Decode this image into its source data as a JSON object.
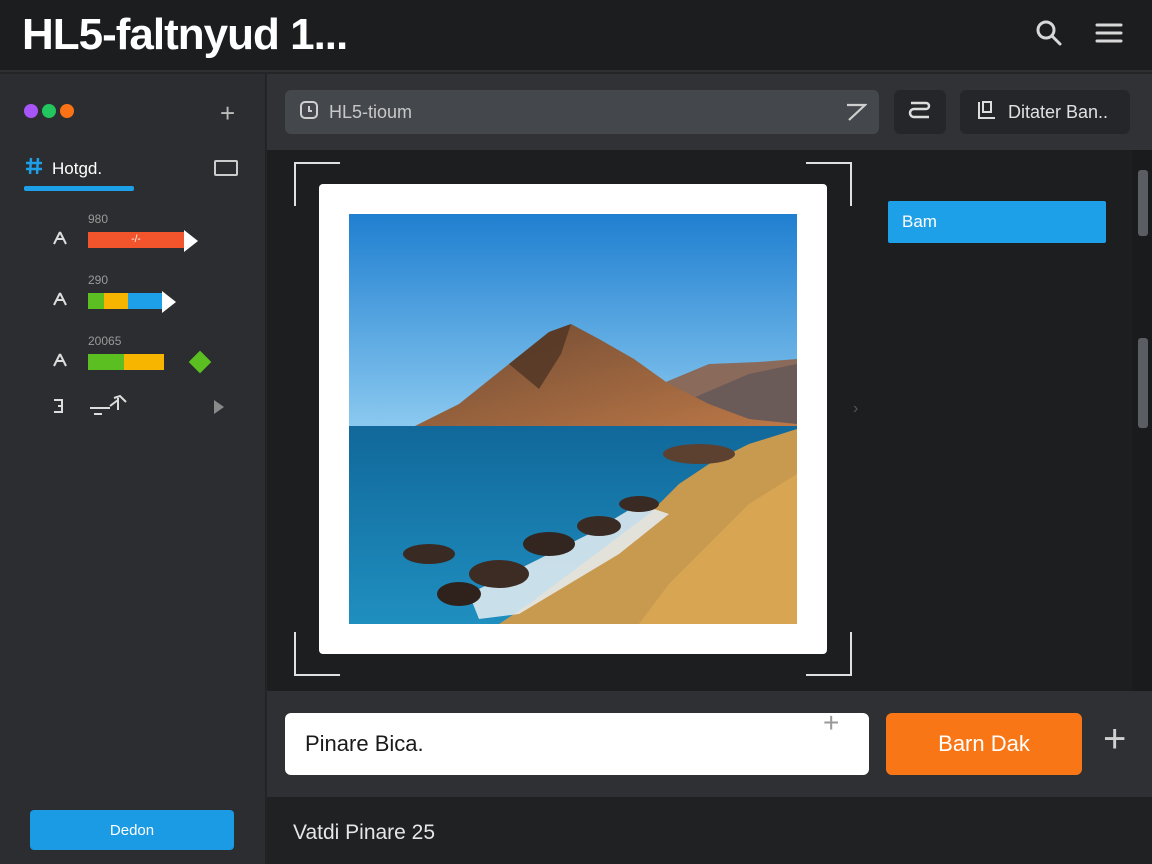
{
  "window": {
    "title": "HL5-faltnyud 1..."
  },
  "colors": {
    "accent_blue": "#1ea0e8",
    "accent_orange": "#f97616",
    "green": "#5bbf21",
    "yellow": "#f7b500",
    "red_orange": "#f2552c"
  },
  "sidebar": {
    "window_dots": [
      "#a855f7",
      "#22c55e",
      "#f97316"
    ],
    "active_tab": {
      "label": "Hotgd."
    },
    "tracks": [
      {
        "value": "980",
        "bar_label": "-/-"
      },
      {
        "value": "290",
        "bar_label": ""
      },
      {
        "value": "20065",
        "bar_label": ""
      }
    ],
    "button_label": "Dedon"
  },
  "toolbar": {
    "search_text": "HL5-tioum",
    "filter_label": "Ditater Ban.."
  },
  "canvas": {
    "tag_label": "Bam"
  },
  "bottom": {
    "input_value": "Pinare Bica.",
    "primary_label": "Barn Dak"
  },
  "status": {
    "text": "Vatdi Pinare 25"
  }
}
